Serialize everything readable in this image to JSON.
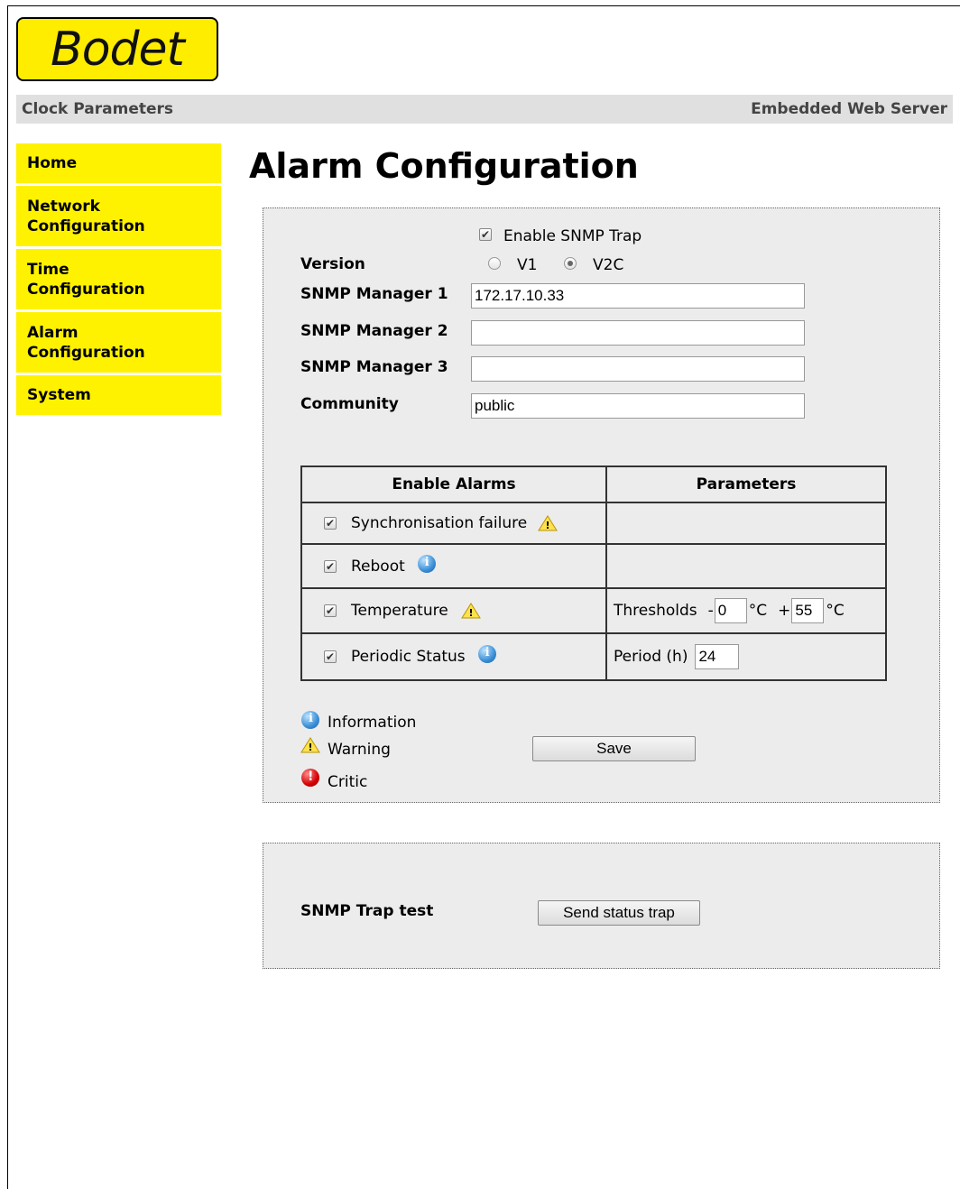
{
  "brand": {
    "logo_text": "Bodet"
  },
  "topbar": {
    "left": "Clock Parameters",
    "right": "Embedded Web Server"
  },
  "nav": {
    "items": [
      {
        "label": "Home"
      },
      {
        "label_l1": "Network",
        "label_l2": "Configuration"
      },
      {
        "label_l1": "Time",
        "label_l2": "Configuration"
      },
      {
        "label_l1": "Alarm",
        "label_l2": "Configuration"
      },
      {
        "label": "System"
      }
    ]
  },
  "page": {
    "title": "Alarm Configuration"
  },
  "snmp": {
    "enable_label": "Enable SNMP Trap",
    "enable_checked": true,
    "version_label": "Version",
    "v1_label": "V1",
    "v2c_label": "V2C",
    "selected_version": "V2C",
    "manager1_label": "SNMP Manager 1",
    "manager1_value": "172.17.10.33",
    "manager2_label": "SNMP Manager 2",
    "manager2_value": "",
    "manager3_label": "SNMP Manager 3",
    "manager3_value": "",
    "community_label": "Community",
    "community_value": "public"
  },
  "alarms": {
    "header_enable": "Enable Alarms",
    "header_params": "Parameters",
    "rows": [
      {
        "label": "Synchronisation failure",
        "checked": true,
        "severity_icon": "warning-icon"
      },
      {
        "label": "Reboot",
        "checked": true,
        "severity_icon": "information-icon"
      },
      {
        "label": "Temperature",
        "checked": true,
        "severity_icon": "warning-icon",
        "param_label": "Thresholds",
        "min_prefix": "-",
        "min_value": "0",
        "unit1": "°C",
        "max_prefix": "+",
        "max_value": "55",
        "unit2": "°C"
      },
      {
        "label": "Periodic Status",
        "checked": true,
        "severity_icon": "information-icon",
        "param_label": "Period (h)",
        "period_value": "24"
      }
    ]
  },
  "legend": {
    "information": "Information",
    "warning": "Warning",
    "critic": "Critic"
  },
  "save_label": "Save",
  "trap_test": {
    "label": "SNMP Trap test",
    "button": "Send status trap"
  },
  "colors": {
    "nav_yellow": "#fff200",
    "logo_yellow": "#ffed00",
    "topbar_gray": "#e0e0e0",
    "panel_gray": "#ececec"
  }
}
